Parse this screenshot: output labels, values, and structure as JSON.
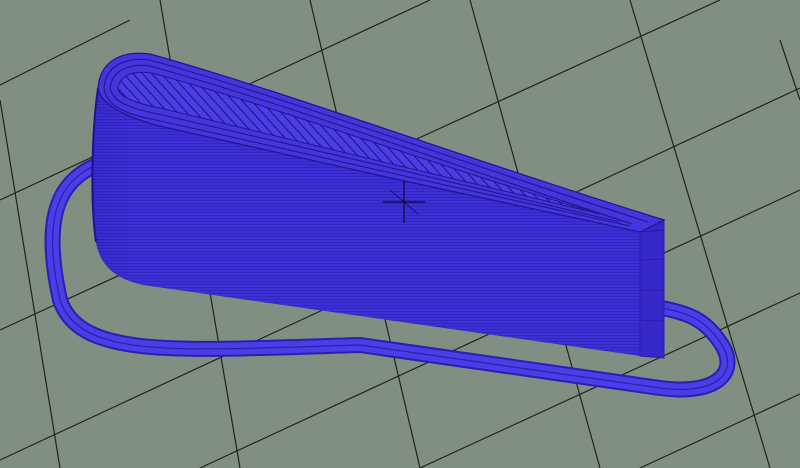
{
  "viewport": {
    "background_color": "#7f9082",
    "grid_color": "#1c241e",
    "model_color": "#3b2fd6",
    "model_shadow_color": "#2a1fb0",
    "model_highlight_color": "#6a5ff0",
    "skirt_color": "#3f33dc",
    "cursor_icon": "crosshair-icon",
    "layer_lines": true,
    "infill_pattern": "diagonal"
  }
}
